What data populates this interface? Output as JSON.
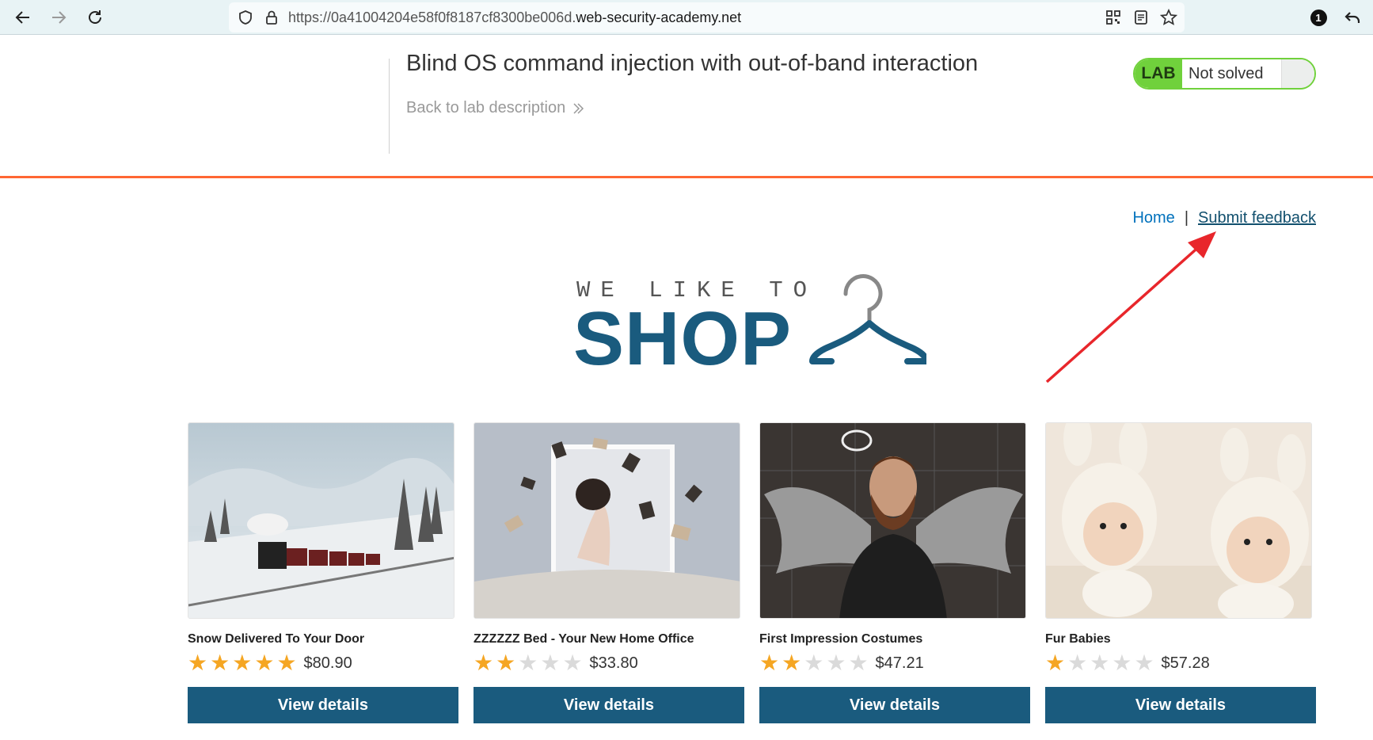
{
  "browser": {
    "url_prefix": "https://0a41004204e58f0f8187cf8300be006d.",
    "url_host": "web-security-academy.net",
    "back_icon": "arrow-left-icon",
    "forward_icon": "arrow-right-icon",
    "reload_icon": "reload-icon",
    "badge_count": "1"
  },
  "lab": {
    "title": "Blind OS command injection with out-of-band interaction",
    "back_link": "Back to lab description",
    "badge_label": "LAB",
    "status": "Not solved",
    "accent_color": "#ff6633",
    "badge_color": "#70d13c"
  },
  "nav": {
    "home": "Home",
    "separator": "|",
    "feedback": "Submit feedback"
  },
  "logo": {
    "small": "WE LIKE TO",
    "big": "SHOP"
  },
  "products": [
    {
      "name": "Snow Delivered To Your Door",
      "rating": 5,
      "price": "$80.90",
      "button": "View details"
    },
    {
      "name": "ZZZZZZ Bed - Your New Home Office",
      "rating": 2,
      "price": "$33.80",
      "button": "View details"
    },
    {
      "name": "First Impression Costumes",
      "rating": 2,
      "price": "$47.21",
      "button": "View details"
    },
    {
      "name": "Fur Babies",
      "rating": 1,
      "price": "$57.28",
      "button": "View details"
    }
  ],
  "theme": {
    "brand_blue": "#1a5b7e",
    "link_blue": "#0071bc",
    "star_color": "#f5a623",
    "annotation_color": "#e8262b"
  }
}
